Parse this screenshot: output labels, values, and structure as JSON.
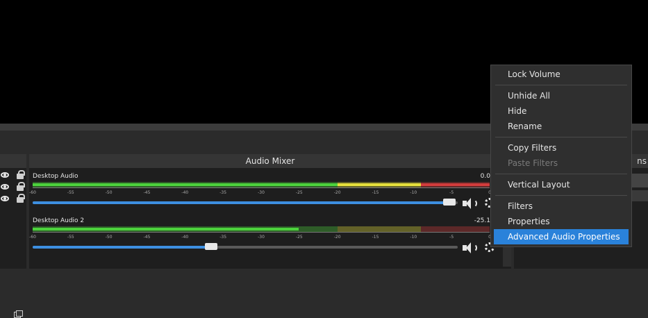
{
  "mixer": {
    "title": "Audio Mixer",
    "tick_labels": [
      "-60",
      "-55",
      "-50",
      "-45",
      "-40",
      "-35",
      "-30",
      "-25",
      "-20",
      "-15",
      "-10",
      "-5",
      "0"
    ],
    "channels": [
      {
        "name": "Desktop Audio",
        "db": "0.0",
        "level_db": 0.0,
        "volume_fraction": 0.98
      },
      {
        "name": "Desktop Audio 2",
        "db": "-25.1",
        "level_db": -25.1,
        "volume_fraction": 0.42
      }
    ]
  },
  "right_dock": {
    "title_fragment": "ns"
  },
  "context_menu": {
    "groups": [
      [
        {
          "label": "Lock Volume"
        }
      ],
      [
        {
          "label": "Unhide All"
        },
        {
          "label": "Hide"
        },
        {
          "label": "Rename"
        }
      ],
      [
        {
          "label": "Copy Filters"
        },
        {
          "label": "Paste Filters",
          "disabled": true
        }
      ],
      [
        {
          "label": "Vertical Layout"
        }
      ],
      [
        {
          "label": "Filters"
        },
        {
          "label": "Properties"
        },
        {
          "label": "Advanced Audio Properties",
          "highlighted": true
        }
      ]
    ]
  },
  "colors": {
    "meter_green": "#4cd23c",
    "meter_yellow": "#e6e03c",
    "meter_red": "#d23c3c",
    "accent": "#2a82da",
    "slider": "#3d8fe0"
  }
}
